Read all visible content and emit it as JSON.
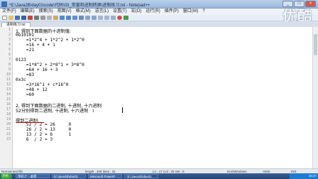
{
  "window": {
    "title": "*E:\\Java2B\\day01\\code\\代码\\03_常量和进制转换\\进制练习.txt - Notepad++",
    "min": "_",
    "max": "□",
    "close": "×"
  },
  "menu": [
    "文件(F)",
    "编辑(E)",
    "搜索(S)",
    "视图(V)",
    "格式(M)",
    "语言(L)",
    "设置(T)",
    "宏(O)",
    "运行(R)",
    "插件(P)",
    "窗口(W)",
    "?"
  ],
  "toolbar_icons": [
    "new-icon",
    "open-icon",
    "save-icon",
    "saveall-icon",
    "close-icon",
    "print-icon",
    "cut-icon",
    "copy-icon",
    "paste-icon",
    "undo-icon",
    "redo-icon",
    "find-icon",
    "replace-icon",
    "zoomin-icon",
    "zoomout-icon",
    "sync-icon",
    "wrap-icon",
    "indent-icon",
    "macro-record-icon",
    "macro-play-icon"
  ],
  "brand": {
    "text": "优酷",
    "sub": "youku.com"
  },
  "tab": {
    "label": "进制练习.txt"
  },
  "editor": {
    "lines": [
      "1, 得到下面数据的十进制值:",
      "0b10101",
      "    =1*2^4 + 1*2^2 + 1*2^0",
      "    =16 + 4 + 1",
      "    =21",
      "",
      "0123",
      "    =1*8^2 + 2*8^1 + 3*8^0",
      "    =64 + 16 + 3",
      "    =83",
      "0x3c",
      "    =3*16^1 + c*16^0",
      "    =48 + 12",
      "    =60",
      "",
      "2, 得到下面数据的二进制, 十进制, 十六进制",
      "52分别得到二进制, 十进制, 十六进制   I",
      "",
      "得到二进制:",
      "    52 / 2 = 26     0",
      "    26 / 2 = 13     0",
      "    13 / 2 = 6      1",
      "    6  / 2 = 3"
    ]
  },
  "status": {
    "type": "Normal text file",
    "length": "length : 345   lines : 31",
    "pos": "Ln : 17   Col : 25   Sel : 0",
    "eol": "Dos\\Windows",
    "enc": "ANSI",
    "mode": "INS"
  },
  "taskbar": {
    "start": "开始",
    "tasks": [
      "单机之 - 桌面",
      "E:\\Java2B\\day01",
      "Microsoft PowerP",
      "*E:\\Java2B\\day01"
    ],
    "clock": "16:47"
  },
  "colors": {
    "accent": "#3a6fb0",
    "taskbar": "#244575"
  }
}
